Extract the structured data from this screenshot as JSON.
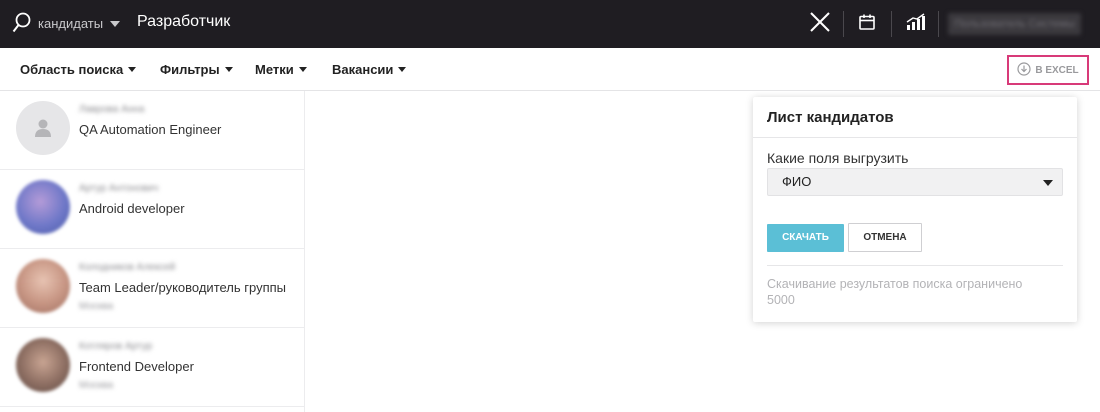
{
  "topbar": {
    "scope_label": "кандидаты",
    "query": "Разработчик",
    "user_name": "Пользователь Системы",
    "icons": {
      "search": "search-icon",
      "close": "close-icon",
      "calendar": "calendar-icon",
      "stats": "stats-icon"
    }
  },
  "filters": {
    "area": "Область поиска",
    "filters": "Фильтры",
    "tags": "Метки",
    "vacancies": "Вакансии",
    "excel": "В EXCEL"
  },
  "candidates": [
    {
      "name": "Лаврова Анна",
      "title": "QA Automation Engineer",
      "sub": ""
    },
    {
      "name": "Артур Антонович",
      "title": "Android developer",
      "sub": ""
    },
    {
      "name": "Колодников Алексей",
      "title": "Team Leader/руководитель группы",
      "sub": "Москва"
    },
    {
      "name": "Котляров Артур",
      "title": "Frontend Developer",
      "sub": "Москва"
    }
  ],
  "panel": {
    "title": "Лист кандидатов",
    "field_label": "Какие поля выгрузить",
    "selected_field": "ФИО",
    "download_label": "СКАЧАТЬ",
    "cancel_label": "ОТМЕНА",
    "note": "Скачивание результатов поиска ограничено 5000"
  },
  "colors": {
    "topbar_bg": "#1f1d22",
    "accent_blue": "#5bbfd6",
    "highlight_pink": "#d83a79"
  }
}
